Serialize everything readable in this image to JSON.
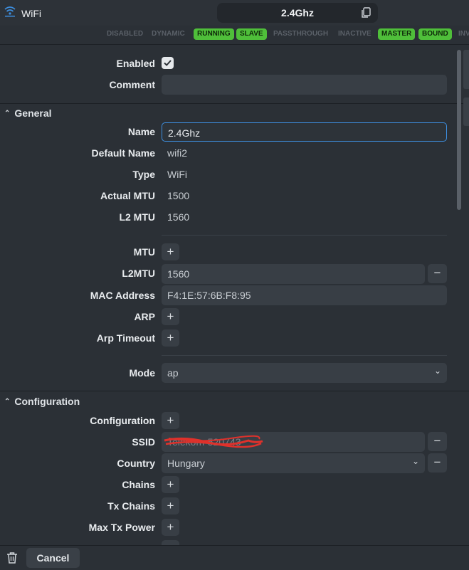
{
  "app": {
    "title": "WiFi"
  },
  "header": {
    "title": "2.4Ghz"
  },
  "flags": [
    {
      "label": "DISABLED",
      "active": false
    },
    {
      "label": "DYNAMIC",
      "active": false
    },
    {
      "label": "RUNNING",
      "active": true
    },
    {
      "label": "SLAVE",
      "active": true
    },
    {
      "label": "PASSTHROUGH",
      "active": false
    },
    {
      "label": "INACTIVE",
      "active": false
    },
    {
      "label": "MASTER",
      "active": true
    },
    {
      "label": "BOUND",
      "active": true
    },
    {
      "label": "INV",
      "active": false
    }
  ],
  "top": {
    "enabled_label": "Enabled",
    "enabled": true,
    "comment_label": "Comment",
    "comment_value": ""
  },
  "general": {
    "section_title": "General",
    "name_label": "Name",
    "name_value": "2.4Ghz",
    "default_name_label": "Default Name",
    "default_name_value": "wifi2",
    "type_label": "Type",
    "type_value": "WiFi",
    "actual_mtu_label": "Actual MTU",
    "actual_mtu_value": "1500",
    "l2mtu_label": "L2 MTU",
    "l2mtu_value": "1560",
    "mtu_label": "MTU",
    "l2mtu_edit_label": "L2MTU",
    "l2mtu_edit_value": "1560",
    "mac_label": "MAC Address",
    "mac_value": "F4:1E:57:6B:F8:95",
    "arp_label": "ARP",
    "arp_timeout_label": "Arp Timeout",
    "mode_label": "Mode",
    "mode_value": "ap"
  },
  "configuration": {
    "section_title": "Configuration",
    "configuration_label": "Configuration",
    "ssid_label": "SSID",
    "ssid_value": "Telekom-520743",
    "country_label": "Country",
    "country_value": "Hungary",
    "chains_label": "Chains",
    "tx_chains_label": "Tx Chains",
    "max_tx_power_label": "Max Tx Power"
  },
  "footer": {
    "cancel_label": "Cancel"
  },
  "symbols": {
    "plus": "+",
    "minus": "−",
    "chevron_down": "⌄",
    "chevron_up": "⌃"
  },
  "colors": {
    "accent": "#3d8fe0",
    "flag_active": "#4fbf3a",
    "background": "#2b3036"
  }
}
